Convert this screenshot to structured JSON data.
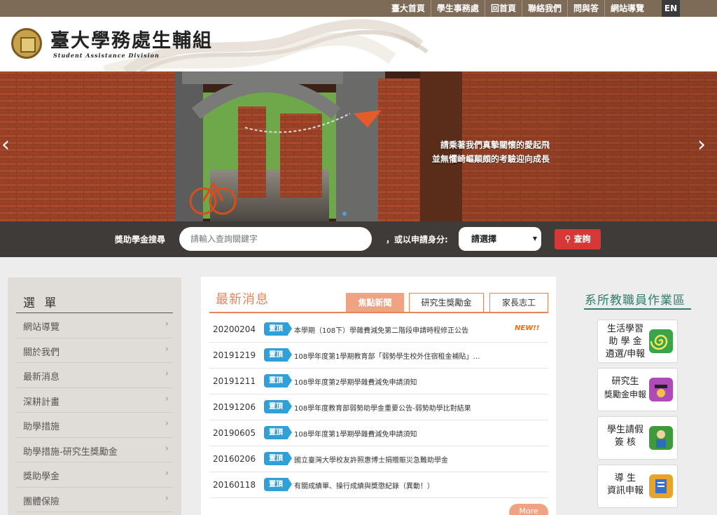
{
  "topnav": {
    "links": [
      "臺大首頁",
      "學生事務處",
      "回首頁",
      "聯絡我們",
      "問與答",
      "網站導覽"
    ],
    "lang": "EN"
  },
  "header": {
    "logo_cn": "臺大學務處生輔組",
    "logo_en": "Student Assistance Division"
  },
  "banner": {
    "caption_line1": "請乘著我們真摯關懷的愛起飛",
    "caption_line2": "並無懼崎嶇顛頗的考驗迎向成長"
  },
  "search": {
    "label": "獎助學金搜尋",
    "placeholder": "請輸入查詢關鍵字",
    "or_label": "，或以申請身分:",
    "select_value": "請選擇",
    "button": "查詢"
  },
  "sidebar": {
    "title": "選 單",
    "items": [
      "網站導覽",
      "關於我們",
      "最新消息",
      "深耕計畫",
      "助學措施",
      "助學措施-研究生獎勵金",
      "獎助學金",
      "團體保險"
    ]
  },
  "news": {
    "title": "最新消息",
    "tabs": [
      "焦點新聞",
      "研究生獎勵金",
      "家長志工"
    ],
    "active_tab": "焦點新聞",
    "badge_label": "置頂",
    "items": [
      {
        "date": "20200204",
        "title": "本學期（108下）學雜費減免第二階段申請時程修正公告",
        "new": "NEW!!"
      },
      {
        "date": "20191219",
        "title": "108學年度第1學期教育部「弱勢學生校外住宿租金補貼」…",
        "new": ""
      },
      {
        "date": "20191211",
        "title": "108學年度第2學期學雜費減免申請須知",
        "new": ""
      },
      {
        "date": "20191206",
        "title": "108學年度教育部弱勢助學金重要公告-弱勢助學比對結果",
        "new": ""
      },
      {
        "date": "20190605",
        "title": "108學年度第1學期學雜費減免申請須知",
        "new": ""
      },
      {
        "date": "20160206",
        "title": "國立臺灣大學校友許照惠博士捐贈賑災急難助學金",
        "new": ""
      },
      {
        "date": "20160118",
        "title": "有關成績單、操行成績與獎懲紀錄（異動！）",
        "new": ""
      }
    ],
    "more": "More"
  },
  "staff": {
    "title": "系所教職員作業區",
    "cards": [
      {
        "lines": [
          "生活學習",
          "助 學 金",
          "遴選/申報"
        ],
        "icon": "spiral-icon",
        "color": "#3aa44a"
      },
      {
        "lines": [
          "研究生",
          "獎勵金申報"
        ],
        "icon": "graduate-icon",
        "color": "#b04ab8"
      },
      {
        "lines": [
          "學生請假",
          "簽 核"
        ],
        "icon": "student-icon",
        "color": "#3e9a3a"
      },
      {
        "lines": [
          "導 生",
          "資訊申報"
        ],
        "icon": "document-icon",
        "color": "#e6a52a"
      }
    ]
  },
  "colors": {
    "topbar": "#7d6a57",
    "news_accent": "#e8835a",
    "badge": "#2fa1d6",
    "search_button": "#d63838",
    "staff_accent": "#2e7d6e"
  }
}
